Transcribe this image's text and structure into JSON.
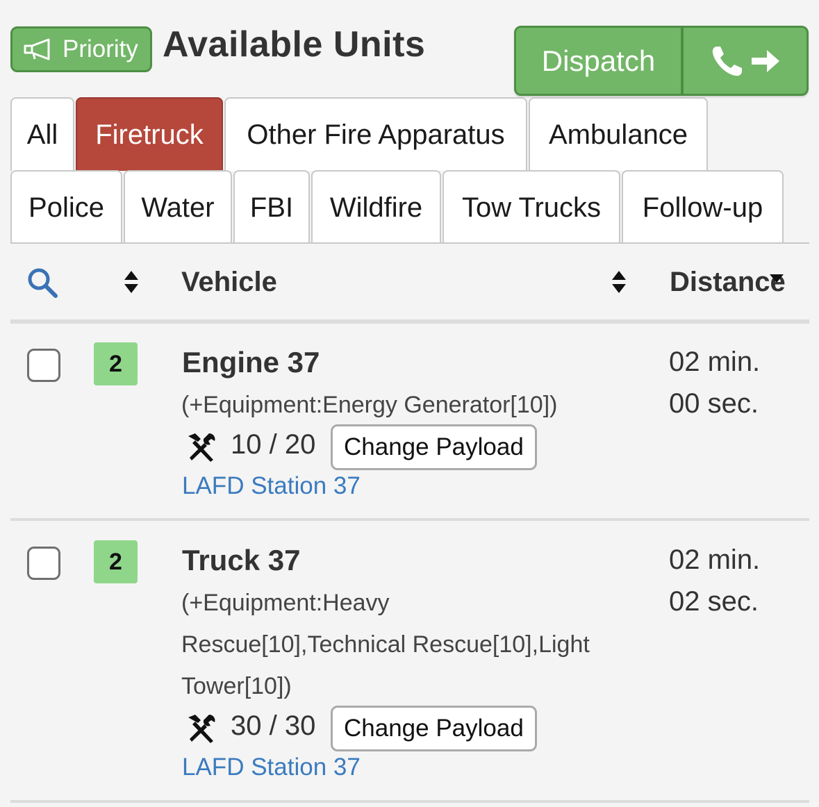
{
  "header": {
    "priority_label": "Priority",
    "title": "Available Units",
    "dispatch_label": "Dispatch"
  },
  "tabs_row1": [
    "All",
    "Firetruck",
    "Other Fire Apparatus",
    "Ambulance"
  ],
  "tabs_row2": [
    "Police",
    "Water",
    "FBI",
    "Wildfire",
    "Tow Trucks",
    "Follow-up"
  ],
  "active_tab": "Firetruck",
  "table": {
    "col_vehicle": "Vehicle",
    "col_distance": "Distance"
  },
  "rows": [
    {
      "badge": "2",
      "name": "Engine 37",
      "equipment_lines": [
        "(+Equipment:Energy Generator[10])"
      ],
      "payload": "10 / 20",
      "payload_button": "Change Payload",
      "station": "LAFD Station 37",
      "distance_min": "02 min.",
      "distance_sec": "00 sec."
    },
    {
      "badge": "2",
      "name": "Truck 37",
      "equipment_lines": [
        "(+Equipment:Heavy",
        "Rescue[10],Technical Rescue[10],Light",
        "Tower[10])"
      ],
      "payload": "30 / 30",
      "payload_button": "Change Payload",
      "station": "LAFD Station 37",
      "distance_min": "02 min.",
      "distance_sec": "02 sec."
    }
  ],
  "colors": {
    "green": "#72b667",
    "active_tab": "#b5473b",
    "badge": "#8fd68a",
    "link": "#3a7bbf"
  },
  "icons": [
    "megaphone-icon",
    "phone-icon",
    "arrow-right-icon",
    "search-icon",
    "sort-icon",
    "tools-icon"
  ]
}
